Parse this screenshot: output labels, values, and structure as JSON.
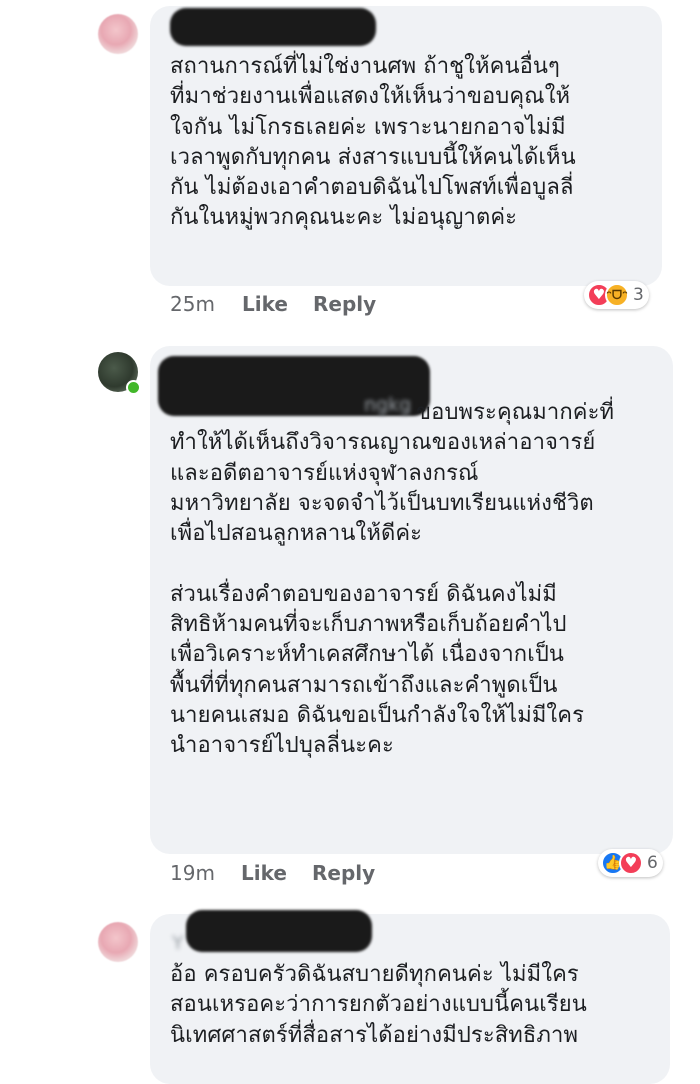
{
  "comments": [
    {
      "text": "สถานการณ์ที่ไม่ใช่งานศพ ถ้าชูให้คนอื่นๆ\nที่มาช่วยงานเพื่อแสดงให้เห็นว่าขอบคุณให้\nใจกัน ไม่โกรธเลยค่ะ เพราะนายกอาจไม่มี\nเวลาพูดกับทุกคน ส่งสารแบบนี้ให้คนได้เห็น\nกัน ไม่ต้องเอาคำตอบดิฉันไปโพสท์เพื่อบูลลี่\nกันในหมู่พวกคุณนะคะ ไม่อนุญาตค่ะ",
      "time": "25m",
      "like_label": "Like",
      "reply_label": "Reply",
      "reaction_count": "3"
    },
    {
      "name_partial": "ngkg",
      "text": "ขอบพระคุณมากค่ะที่\nทำให้ได้เห็นถึงวิจารณญาณของเหล่าอาจารย์\nและอดีตอาจารย์แห่งจุฬาลงกรณ์\nมหาวิทยาลัย จะจดจำไว้เป็นบทเรียนแห่งชีวิต\nเพื่อไปสอนลูกหลานให้ดีค่ะ\n\nส่วนเรื่องคำตอบของอาจารย์ ดิฉันคงไม่มี\nสิทธิห้ามคนที่จะเก็บภาพหรือเก็บถ้อยคำไป\nเพื่อวิเคราะห์ทำเคสศึกษาได้ เนื่องจากเป็น\nพื้นที่ที่ทุกคนสามารถเข้าถึงและคำพูดเป็น\nนายคนเสมอ ดิฉันขอเป็นกำลังใจให้ไม่มีใคร\nนำอาจารย์ไปบุลลี่นะคะ",
      "time": "19m",
      "like_label": "Like",
      "reply_label": "Reply",
      "reaction_count": "6"
    },
    {
      "name_partial": "Y",
      "text": "อ้อ ครอบครัวดิฉันสบายดีทุกคนค่ะ ไม่มีใคร\nสอนเหรอคะว่าการยกตัวอย่างแบบนี้คนเรียน\nนิเทศศาสตร์ที่สื่อสารได้อย่างมีประสิทธิภาพ"
    }
  ],
  "icons": {
    "love": "heart-icon",
    "haha": "haha-icon",
    "like": "thumbs-up-icon"
  },
  "colors": {
    "bubble": "#f0f2f5",
    "meta": "#65676b",
    "love": "#f33e58",
    "like": "#1877f2",
    "haha": "#f7b125"
  }
}
